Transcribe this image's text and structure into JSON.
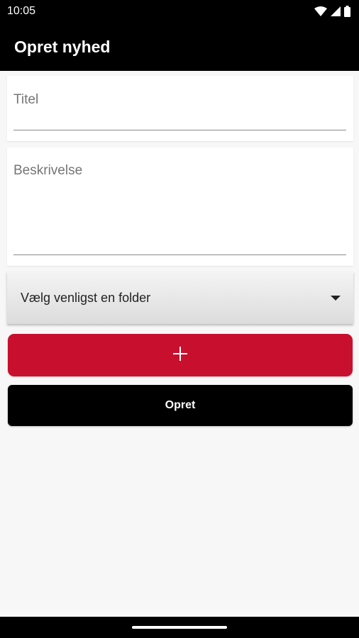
{
  "status_bar": {
    "time": "10:05",
    "icons": [
      "wifi-icon",
      "signal-icon",
      "battery-icon"
    ]
  },
  "app_bar": {
    "title": "Opret nyhed"
  },
  "form": {
    "title_placeholder": "Titel",
    "description_placeholder": "Beskrivelse",
    "folder_select": {
      "selected": "Vælg venligst en folder",
      "icon": "dropdown-arrow-icon"
    },
    "add_button": {
      "icon": "plus-icon"
    },
    "create_button_label": "Opret"
  },
  "colors": {
    "app_bar": "#000000",
    "background": "#f7f7f7",
    "add_button": "#c8102e",
    "create_button": "#000000"
  }
}
